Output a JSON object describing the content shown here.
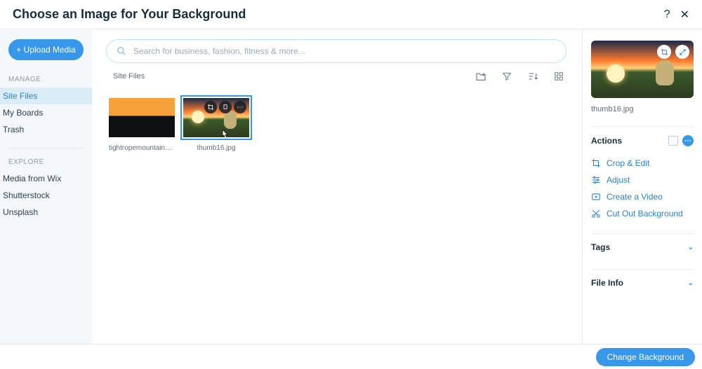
{
  "header": {
    "title": "Choose an Image for Your Background"
  },
  "sidebar": {
    "upload_label": "+ Upload Media",
    "manage_label": "MANAGE",
    "explore_label": "EXPLORE",
    "manage_items": [
      "Site Files",
      "My Boards",
      "Trash"
    ],
    "explore_items": [
      "Media from Wix",
      "Shutterstock",
      "Unsplash"
    ]
  },
  "search": {
    "placeholder": "Search for business, fashion, fitness & more..."
  },
  "breadcrumb": "Site Files",
  "gallery": {
    "items": [
      {
        "name": "tightropemountains.jpg",
        "kind": "tightrope",
        "selected": false
      },
      {
        "name": "thumb16.jpg",
        "kind": "sunset",
        "selected": true
      }
    ]
  },
  "rightpane": {
    "filename": "thumb16.jpg",
    "actions_label": "Actions",
    "actions": [
      "Crop & Edit",
      "Adjust",
      "Create a Video",
      "Cut Out Background"
    ],
    "tags_label": "Tags",
    "fileinfo_label": "File Info"
  },
  "footer": {
    "primary": "Change Background"
  }
}
